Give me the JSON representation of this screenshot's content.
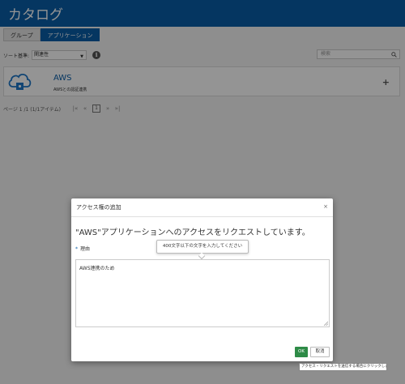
{
  "header": {
    "title": "カタログ"
  },
  "tabs": [
    {
      "label": "グループ",
      "active": false
    },
    {
      "label": "アプリケーション",
      "active": true
    }
  ],
  "sort": {
    "label": "ソート基準:",
    "value": "関連性"
  },
  "search": {
    "placeholder": "検索"
  },
  "catalog_items": [
    {
      "title": "AWS",
      "description": "AWSとの認証連携"
    }
  ],
  "pager": {
    "info": "ページ 1 /1 (1/1アイテム)",
    "current": "1",
    "first": "|«",
    "prev": "«",
    "next": "»",
    "last": "»|"
  },
  "modal": {
    "title": "アクセス権の追加",
    "close": "×",
    "heading": "\"AWS\"アプリケーションへのアクセスをリクエストしています。",
    "reason_required_mark": "*",
    "reason_label": "理由",
    "reason_value": "AWS連携のため",
    "reason_tooltip": "400文字以下の文字を入力してください",
    "ok_label": "OK",
    "cancel_label": "取消",
    "ok_tooltip": "アクセス・リクエストを送信する場合にクリックします。"
  },
  "colors": {
    "brand": "#0a5ea8",
    "ok_button": "#2e8b47"
  }
}
